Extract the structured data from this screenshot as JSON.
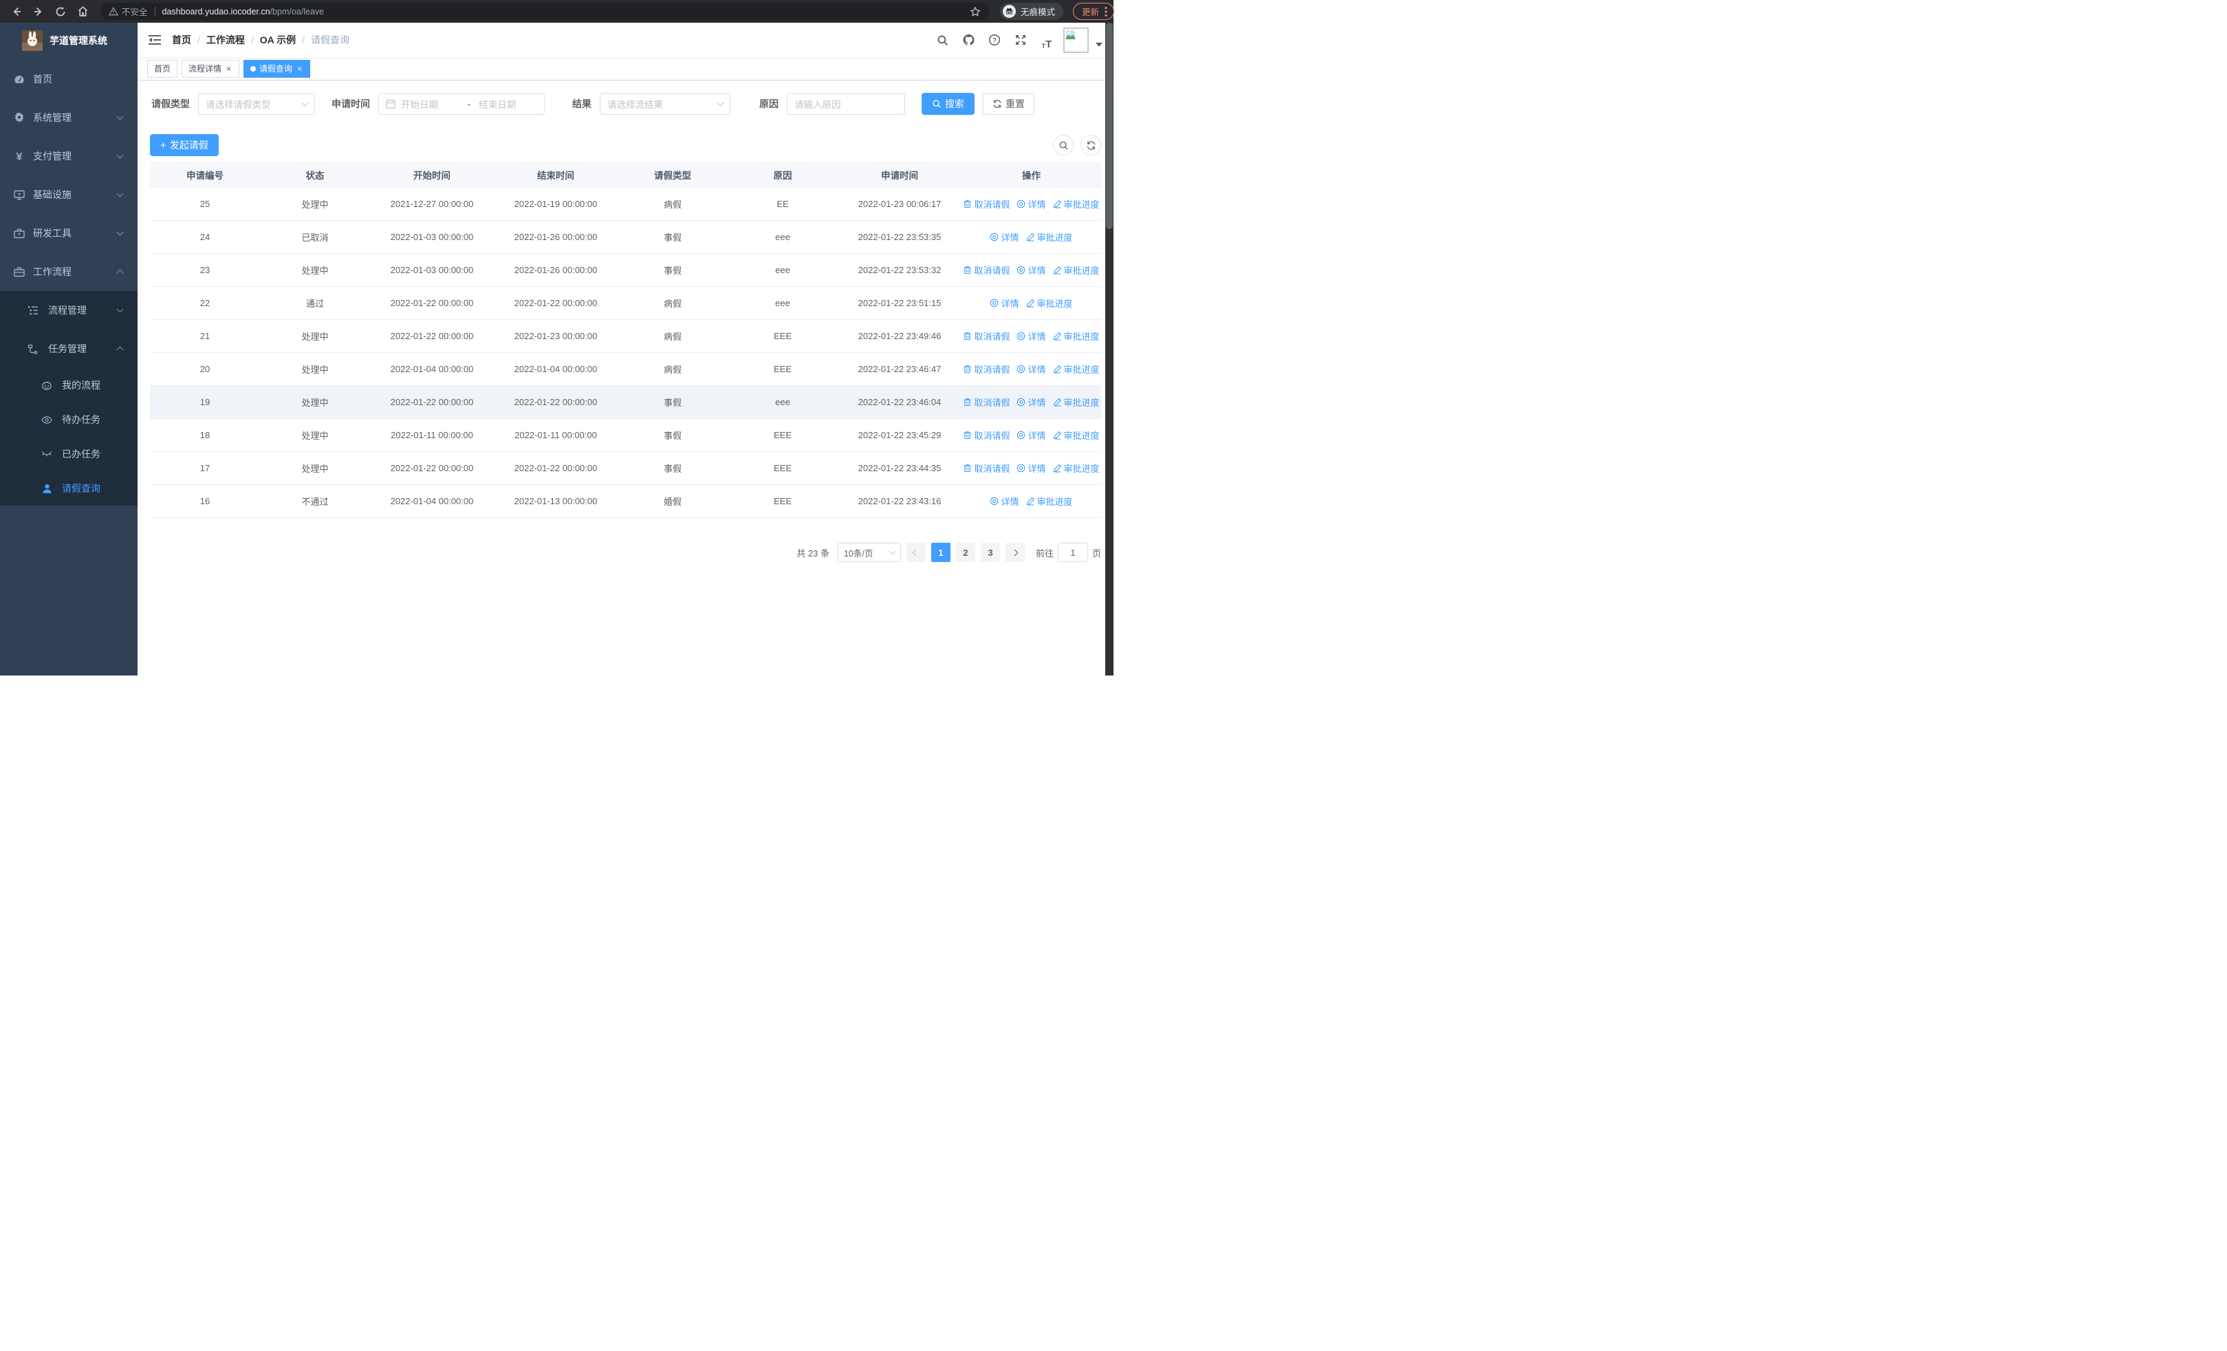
{
  "colors": {
    "primary": "#409eff",
    "sidebar_bg": "#304156",
    "submenu_bg": "#1f2d3d",
    "chrome_bg": "#2a2b2e",
    "update_accent": "#ee8278"
  },
  "browser": {
    "security_label": "不安全",
    "url_host": "dashboard.yudao.iocoder.cn",
    "url_path": "/bpm/oa/leave",
    "incognito_label": "无痕模式",
    "update_label": "更新"
  },
  "sidebar": {
    "app_title": "芋道管理系统",
    "items": [
      {
        "label": "首页",
        "icon": "dashboard-icon",
        "level": 1
      },
      {
        "label": "系统管理",
        "icon": "gear-icon",
        "level": 1,
        "chevron": "down"
      },
      {
        "label": "支付管理",
        "icon": "yen-icon",
        "level": 1,
        "chevron": "down"
      },
      {
        "label": "基础设施",
        "icon": "monitor-icon",
        "level": 1,
        "chevron": "down"
      },
      {
        "label": "研发工具",
        "icon": "toolbox-icon",
        "level": 1,
        "chevron": "down"
      },
      {
        "label": "工作流程",
        "icon": "briefcase-icon",
        "level": 1,
        "chevron": "up"
      },
      {
        "label": "流程管理",
        "icon": "tree-list-icon",
        "level": 2,
        "chevron": "down"
      },
      {
        "label": "任务管理",
        "icon": "flow-icon",
        "level": 2,
        "chevron": "up"
      },
      {
        "label": "我的流程",
        "icon": "robot-icon",
        "level": 3
      },
      {
        "label": "待办任务",
        "icon": "eye-open-icon",
        "level": 3
      },
      {
        "label": "已办任务",
        "icon": "eye-closed-icon",
        "level": 3
      },
      {
        "label": "请假查询",
        "icon": "user-icon",
        "level": 3,
        "active": true
      }
    ]
  },
  "header": {
    "breadcrumb": [
      "首页",
      "工作流程",
      "OA 示例",
      "请假查询"
    ]
  },
  "tags": [
    {
      "label": "首页",
      "closable": false,
      "active": false
    },
    {
      "label": "流程详情",
      "closable": true,
      "active": false
    },
    {
      "label": "请假查询",
      "closable": true,
      "active": true
    }
  ],
  "filters": {
    "leave_type_label": "请假类型",
    "leave_type_placeholder": "请选择请假类型",
    "apply_time_label": "申请时间",
    "start_date_placeholder": "开始日期",
    "range_separator": "-",
    "end_date_placeholder": "结束日期",
    "result_label": "结果",
    "result_placeholder": "请选择流结果",
    "reason_label": "原因",
    "reason_placeholder": "请输入原因",
    "search_label": "搜索",
    "reset_label": "重置"
  },
  "toolbar": {
    "create_label": "发起请假"
  },
  "table": {
    "columns": [
      "申请编号",
      "状态",
      "开始时间",
      "结束时间",
      "请假类型",
      "原因",
      "申请时间",
      "操作"
    ],
    "rows": [
      {
        "id": "25",
        "status": "处理中",
        "start": "2021-12-27 00:00:00",
        "end": "2022-01-19 00:00:00",
        "type": "病假",
        "reason": "EE",
        "applied": "2022-01-23 00:06:17",
        "highlighted": false,
        "actions": [
          {
            "label": "取消请假",
            "icon": "delete-icon"
          },
          {
            "label": "详情",
            "icon": "view-icon"
          },
          {
            "label": "审批进度",
            "icon": "edit-icon"
          }
        ]
      },
      {
        "id": "24",
        "status": "已取消",
        "start": "2022-01-03 00:00:00",
        "end": "2022-01-26 00:00:00",
        "type": "事假",
        "reason": "eee",
        "applied": "2022-01-22 23:53:35",
        "highlighted": false,
        "actions": [
          {
            "label": "详情",
            "icon": "view-icon"
          },
          {
            "label": "审批进度",
            "icon": "edit-icon"
          }
        ]
      },
      {
        "id": "23",
        "status": "处理中",
        "start": "2022-01-03 00:00:00",
        "end": "2022-01-26 00:00:00",
        "type": "事假",
        "reason": "eee",
        "applied": "2022-01-22 23:53:32",
        "highlighted": false,
        "actions": [
          {
            "label": "取消请假",
            "icon": "delete-icon"
          },
          {
            "label": "详情",
            "icon": "view-icon"
          },
          {
            "label": "审批进度",
            "icon": "edit-icon"
          }
        ]
      },
      {
        "id": "22",
        "status": "通过",
        "start": "2022-01-22 00:00:00",
        "end": "2022-01-22 00:00:00",
        "type": "病假",
        "reason": "eee",
        "applied": "2022-01-22 23:51:15",
        "highlighted": false,
        "actions": [
          {
            "label": "详情",
            "icon": "view-icon"
          },
          {
            "label": "审批进度",
            "icon": "edit-icon"
          }
        ]
      },
      {
        "id": "21",
        "status": "处理中",
        "start": "2022-01-22 00:00:00",
        "end": "2022-01-23 00:00:00",
        "type": "病假",
        "reason": "EEE",
        "applied": "2022-01-22 23:49:46",
        "highlighted": false,
        "actions": [
          {
            "label": "取消请假",
            "icon": "delete-icon"
          },
          {
            "label": "详情",
            "icon": "view-icon"
          },
          {
            "label": "审批进度",
            "icon": "edit-icon"
          }
        ]
      },
      {
        "id": "20",
        "status": "处理中",
        "start": "2022-01-04 00:00:00",
        "end": "2022-01-04 00:00:00",
        "type": "病假",
        "reason": "EEE",
        "applied": "2022-01-22 23:46:47",
        "highlighted": false,
        "actions": [
          {
            "label": "取消请假",
            "icon": "delete-icon"
          },
          {
            "label": "详情",
            "icon": "view-icon"
          },
          {
            "label": "审批进度",
            "icon": "edit-icon"
          }
        ]
      },
      {
        "id": "19",
        "status": "处理中",
        "start": "2022-01-22 00:00:00",
        "end": "2022-01-22 00:00:00",
        "type": "事假",
        "reason": "eee",
        "applied": "2022-01-22 23:46:04",
        "highlighted": true,
        "actions": [
          {
            "label": "取消请假",
            "icon": "delete-icon"
          },
          {
            "label": "详情",
            "icon": "view-icon"
          },
          {
            "label": "审批进度",
            "icon": "edit-icon"
          }
        ]
      },
      {
        "id": "18",
        "status": "处理中",
        "start": "2022-01-11 00:00:00",
        "end": "2022-01-11 00:00:00",
        "type": "事假",
        "reason": "EEE",
        "applied": "2022-01-22 23:45:29",
        "highlighted": false,
        "actions": [
          {
            "label": "取消请假",
            "icon": "delete-icon"
          },
          {
            "label": "详情",
            "icon": "view-icon"
          },
          {
            "label": "审批进度",
            "icon": "edit-icon"
          }
        ]
      },
      {
        "id": "17",
        "status": "处理中",
        "start": "2022-01-22 00:00:00",
        "end": "2022-01-22 00:00:00",
        "type": "事假",
        "reason": "EEE",
        "applied": "2022-01-22 23:44:35",
        "highlighted": false,
        "actions": [
          {
            "label": "取消请假",
            "icon": "delete-icon"
          },
          {
            "label": "详情",
            "icon": "view-icon"
          },
          {
            "label": "审批进度",
            "icon": "edit-icon"
          }
        ]
      },
      {
        "id": "16",
        "status": "不通过",
        "start": "2022-01-04 00:00:00",
        "end": "2022-01-13 00:00:00",
        "type": "婚假",
        "reason": "EEE",
        "applied": "2022-01-22 23:43:16",
        "highlighted": false,
        "actions": [
          {
            "label": "详情",
            "icon": "view-icon"
          },
          {
            "label": "审批进度",
            "icon": "edit-icon"
          }
        ]
      }
    ]
  },
  "pagination": {
    "total_label": "共 23 条",
    "page_size_label": "10条/页",
    "pages": [
      {
        "label": "1",
        "active": true
      },
      {
        "label": "2",
        "active": false
      },
      {
        "label": "3",
        "active": false
      }
    ],
    "goto_label": "前往",
    "goto_value": "1",
    "page_unit_label": "页"
  }
}
